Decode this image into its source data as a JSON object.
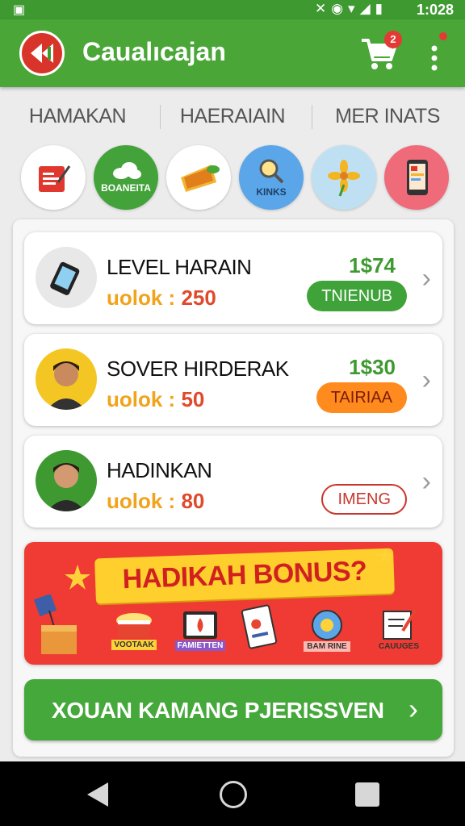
{
  "status_bar": {
    "time": "1:028",
    "icons": [
      "notification-icon",
      "mute-icon",
      "alarm-icon",
      "wifi-icon",
      "signal-icon",
      "battery-icon"
    ]
  },
  "app_bar": {
    "title": "Caualıcajan",
    "cart_badge": "2"
  },
  "tabs": [
    {
      "label": "HAMAKAN"
    },
    {
      "label": "HAERAIAIN"
    },
    {
      "label": "MER INATS"
    }
  ],
  "categories": [
    {
      "icon": "notepad-icon",
      "label": "",
      "color": "#ffffff"
    },
    {
      "icon": "cloud-icon",
      "label": "BOANEITA",
      "color": "#43a33a"
    },
    {
      "icon": "food-icon",
      "label": "",
      "color": "#ffffff"
    },
    {
      "icon": "search-icon",
      "label": "KINKS",
      "color": "#5aa6e8"
    },
    {
      "icon": "flower-icon",
      "label": "",
      "color": "#bfe0f3"
    },
    {
      "icon": "phone-icon",
      "label": "",
      "color": "#ef6b7a"
    }
  ],
  "items": [
    {
      "name": "LEVEL HARAIN",
      "sub_key": "uolok :",
      "sub_value": "250",
      "price": "1$74",
      "action": "TNIENUB",
      "action_style": "green",
      "avatar": "phone-avatar"
    },
    {
      "name": "SOVER HIRDERAK",
      "sub_key": "uolok :",
      "sub_value": "50",
      "price": "1$30",
      "action": "TAIRIAA",
      "action_style": "orange",
      "avatar": "person-avatar"
    },
    {
      "name": "HADINKAN",
      "sub_key": "uolok :",
      "sub_value": "80",
      "price": "",
      "action": "IMENG",
      "action_style": "outline",
      "avatar": "person-avatar"
    }
  ],
  "banner": {
    "title": "HADIKAH BONUS?",
    "items": [
      {
        "icon": "gift-box-icon",
        "label": ""
      },
      {
        "icon": "popcorn-icon",
        "label": "VOOTAAK"
      },
      {
        "icon": "tablet-icon",
        "label": "FAMIETTEN"
      },
      {
        "icon": "card-icon",
        "label": ""
      },
      {
        "icon": "badge-icon",
        "label": "BAM RINE"
      },
      {
        "icon": "notes-icon",
        "label": "CAUUGES"
      }
    ]
  },
  "cta": {
    "label": "XOUAN KAMANG PJERISSVEN"
  },
  "colors": {
    "primary": "#4aa637",
    "accent_red": "#ef3b33",
    "price_green": "#3e9a30",
    "value_red": "#e0492b",
    "key_orange": "#f0a31b"
  }
}
